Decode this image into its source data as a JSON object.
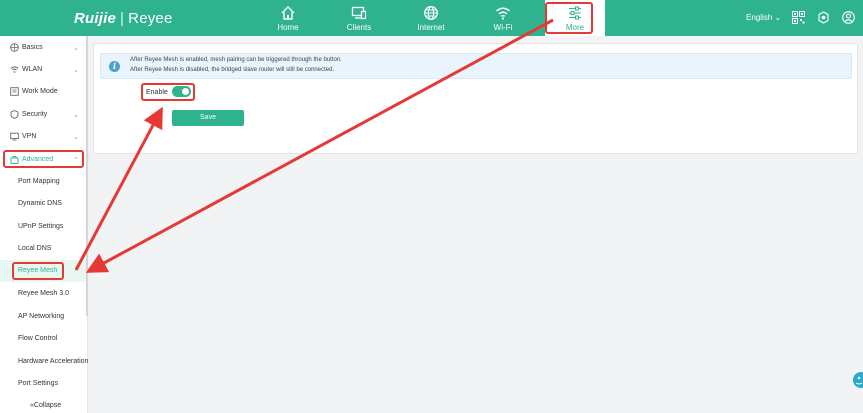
{
  "brand": {
    "logo_text": "Ruijie",
    "separator": "|",
    "sub_brand": "Reyee"
  },
  "nav": {
    "home": "Home",
    "clients": "Clients",
    "internet": "Internet",
    "wifi": "Wi-Fi",
    "more": "More"
  },
  "header": {
    "language": "English ⌄"
  },
  "sidebar": {
    "basics": "Basics",
    "wlan": "WLAN",
    "work_mode": "Work Mode",
    "security": "Security",
    "vpn": "VPN",
    "advanced": "Advanced",
    "sub": {
      "port_mapping": "Port Mapping",
      "dynamic_dns": "Dynamic DNS",
      "upnp": "UPnP Settings",
      "local_dns": "Local DNS",
      "reyee_mesh": "Reyee Mesh",
      "reyee_mesh3": "Reyee Mesh 3.0",
      "ap_networking": "AP Networking",
      "flow_control": "Flow Control",
      "hw_accel": "Hardware Acceleration",
      "port_settings": "Port Settings"
    },
    "collapse": "«Collapse"
  },
  "main": {
    "info_line1": "After Reyee Mesh is enabled, mesh pairing can be triggered through the button.",
    "info_line2": "After Reyee Mesh is disabled, the bridged slave router will still be connected.",
    "enable_label": "Enable",
    "enable_state": true,
    "save_label": "Save"
  },
  "colors": {
    "brand": "#2fb38e",
    "annotation": "#e53935",
    "info_bg": "#eaf4fc"
  }
}
